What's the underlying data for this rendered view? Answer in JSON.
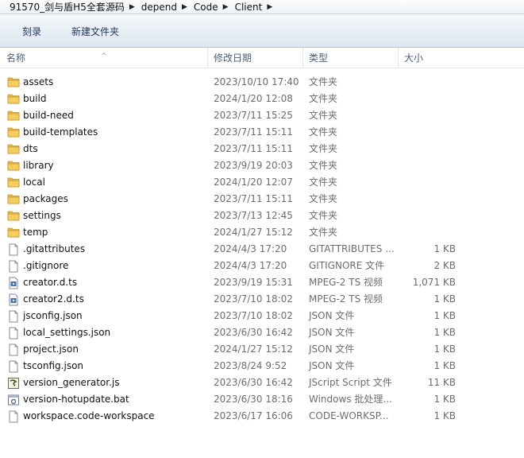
{
  "breadcrumb": [
    "91570_剑与盾H5全套源码",
    "depend",
    "Code",
    "Client"
  ],
  "toolbar": {
    "burn_label": "刻录",
    "new_folder_label": "新建文件夹"
  },
  "columns": {
    "name": "名称",
    "date": "修改日期",
    "type": "类型",
    "size": "大小"
  },
  "files": [
    {
      "name": "assets",
      "date": "2023/10/10 17:40",
      "type": "文件夹",
      "size": "",
      "icon": "folder-icon"
    },
    {
      "name": "build",
      "date": "2024/1/20 12:08",
      "type": "文件夹",
      "size": "",
      "icon": "folder-icon"
    },
    {
      "name": "build-need",
      "date": "2023/7/11 15:25",
      "type": "文件夹",
      "size": "",
      "icon": "folder-icon"
    },
    {
      "name": "build-templates",
      "date": "2023/7/11 15:11",
      "type": "文件夹",
      "size": "",
      "icon": "folder-icon"
    },
    {
      "name": "dts",
      "date": "2023/7/11 15:11",
      "type": "文件夹",
      "size": "",
      "icon": "folder-icon"
    },
    {
      "name": "library",
      "date": "2023/9/19 20:03",
      "type": "文件夹",
      "size": "",
      "icon": "folder-icon"
    },
    {
      "name": "local",
      "date": "2024/1/20 12:07",
      "type": "文件夹",
      "size": "",
      "icon": "folder-icon"
    },
    {
      "name": "packages",
      "date": "2023/7/11 15:11",
      "type": "文件夹",
      "size": "",
      "icon": "folder-icon"
    },
    {
      "name": "settings",
      "date": "2023/7/13 12:45",
      "type": "文件夹",
      "size": "",
      "icon": "folder-icon"
    },
    {
      "name": "temp",
      "date": "2024/1/27 15:12",
      "type": "文件夹",
      "size": "",
      "icon": "folder-icon"
    },
    {
      "name": ".gitattributes",
      "date": "2024/4/3 17:20",
      "type": "GITATTRIBUTES ...",
      "size": "1 KB",
      "icon": "file-icon"
    },
    {
      "name": ".gitignore",
      "date": "2024/4/3 17:20",
      "type": "GITIGNORE 文件",
      "size": "2 KB",
      "icon": "file-icon"
    },
    {
      "name": "creator.d.ts",
      "date": "2023/9/19 15:31",
      "type": "MPEG-2 TS 视频",
      "size": "1,071 KB",
      "icon": "video-file-icon"
    },
    {
      "name": "creator2.d.ts",
      "date": "2023/7/10 18:02",
      "type": "MPEG-2 TS 视频",
      "size": "1 KB",
      "icon": "video-file-icon"
    },
    {
      "name": "jsconfig.json",
      "date": "2023/7/10 18:02",
      "type": "JSON 文件",
      "size": "1 KB",
      "icon": "file-icon"
    },
    {
      "name": "local_settings.json",
      "date": "2023/6/30 16:42",
      "type": "JSON 文件",
      "size": "1 KB",
      "icon": "file-icon"
    },
    {
      "name": "project.json",
      "date": "2024/1/27 15:12",
      "type": "JSON 文件",
      "size": "1 KB",
      "icon": "file-icon"
    },
    {
      "name": "tsconfig.json",
      "date": "2023/8/24 9:52",
      "type": "JSON 文件",
      "size": "1 KB",
      "icon": "file-icon"
    },
    {
      "name": "version_generator.js",
      "date": "2023/6/30 16:42",
      "type": "JScript Script 文件",
      "size": "11 KB",
      "icon": "script-file-icon"
    },
    {
      "name": "version-hotupdate.bat",
      "date": "2023/6/30 18:16",
      "type": "Windows 批处理...",
      "size": "1 KB",
      "icon": "batch-file-icon"
    },
    {
      "name": "workspace.code-workspace",
      "date": "2023/6/17 16:06",
      "type": "CODE-WORKSP...",
      "size": "1 KB",
      "icon": "file-icon"
    }
  ],
  "colors": {
    "folder": "#e8b73c",
    "accent": "#1e395b"
  }
}
